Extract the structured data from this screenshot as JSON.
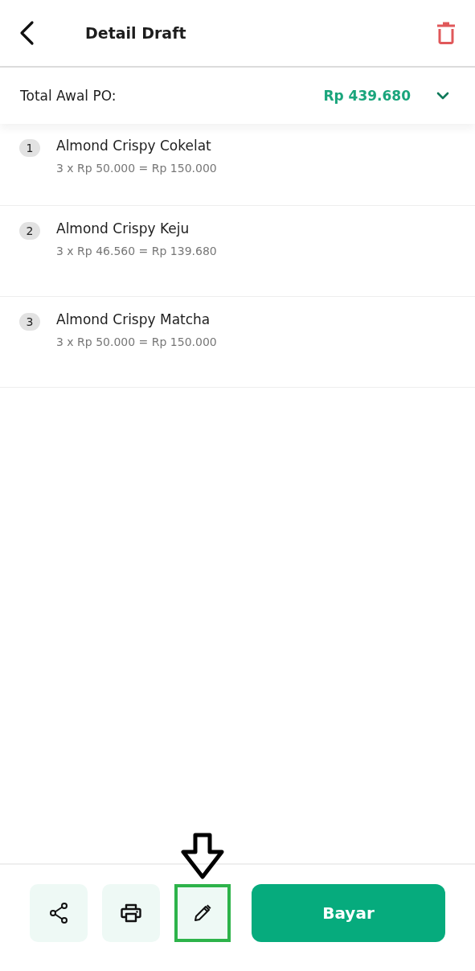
{
  "header": {
    "title": "Detail Draft"
  },
  "summary": {
    "label": "Total Awal PO:",
    "amount": "Rp 439.680",
    "expanded": false
  },
  "items": [
    {
      "number": "1",
      "name": "Almond Crispy Cokelat",
      "detail": "3 x Rp 50.000 = Rp 150.000"
    },
    {
      "number": "2",
      "name": "Almond Crispy Keju",
      "detail": "3 x Rp 46.560 = Rp 139.680"
    },
    {
      "number": "3",
      "name": "Almond Crispy Matcha",
      "detail": "3 x Rp 50.000 = Rp 150.000"
    }
  ],
  "actions": [
    {
      "kind": "share",
      "highlighted": false
    },
    {
      "kind": "print",
      "highlighted": false
    },
    {
      "kind": "edit",
      "highlighted": true
    }
  ],
  "pay_button": {
    "label": "Bayar"
  }
}
